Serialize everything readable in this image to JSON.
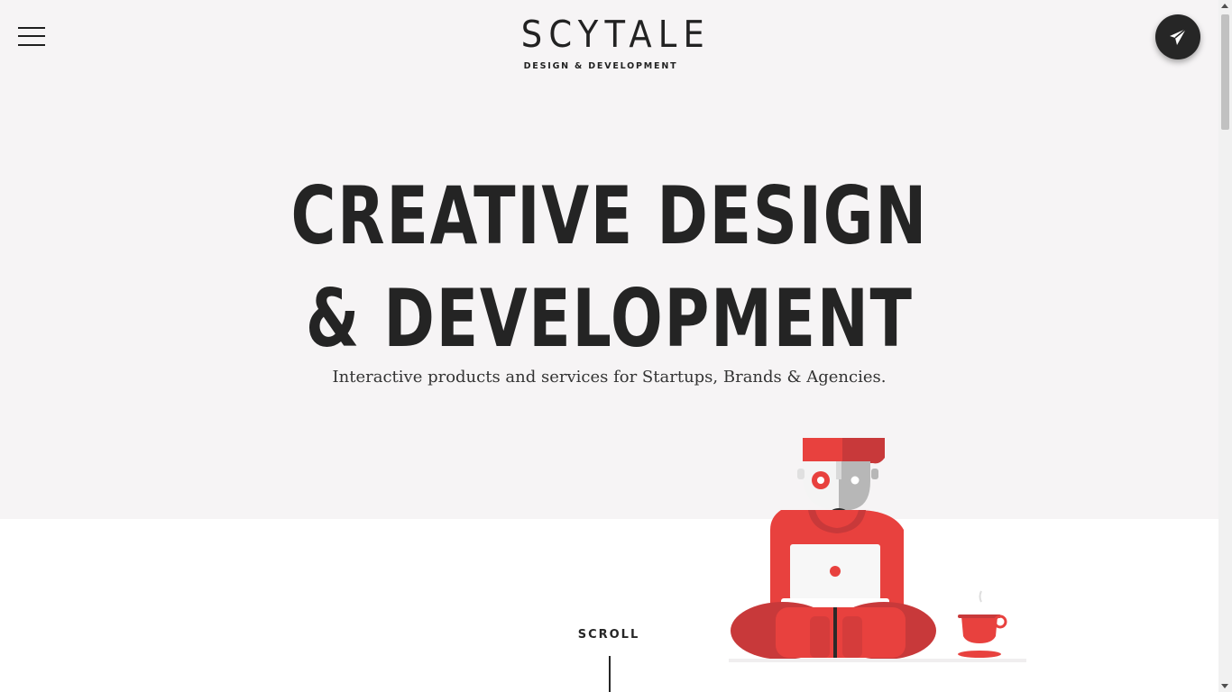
{
  "header": {
    "logo_wordmark": "SCYTALE",
    "logo_tagline": "DESIGN & DEVELOPMENT",
    "menu_icon": "hamburger-menu-icon",
    "contact_icon": "paper-plane-icon"
  },
  "hero": {
    "headline_line1": "CREATIVE DESIGN",
    "headline_line2": "& DEVELOPMENT",
    "subtitle": "Interactive products and services for Startups, Brands & Agencies.",
    "illustration": "developer-with-laptop-and-coffee"
  },
  "scroll_indicator": {
    "label": "SCROLL"
  },
  "colors": {
    "hero_background": "#f6f4f5",
    "text": "#242424",
    "accent_red": "#e8413e",
    "dark_red": "#b83434"
  }
}
